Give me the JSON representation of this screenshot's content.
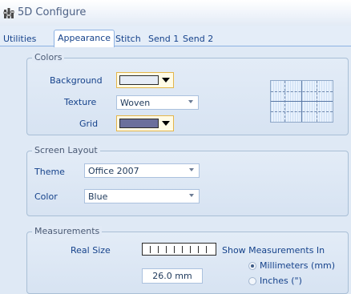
{
  "window": {
    "title": "5D Configure",
    "icon": "configure-app-icon"
  },
  "tabs": [
    {
      "label": "Utilities",
      "active": false
    },
    {
      "label": "Appearance",
      "active": true
    },
    {
      "label": "Stitch",
      "active": false
    },
    {
      "label": "Send 1",
      "active": false
    },
    {
      "label": "Send 2",
      "active": false
    }
  ],
  "colors_group": {
    "title": "Colors",
    "background": {
      "label": "Background",
      "color": "#e6ecf6"
    },
    "texture": {
      "label": "Texture",
      "value": "Woven"
    },
    "grid": {
      "label": "Grid",
      "color": "#6b6f9c"
    }
  },
  "screen_layout_group": {
    "title": "Screen Layout",
    "theme": {
      "label": "Theme",
      "value": "Office 2007"
    },
    "color": {
      "label": "Color",
      "value": "Blue"
    }
  },
  "measurements_group": {
    "title": "Measurements",
    "real_size_label": "Real Size",
    "real_size_value": "26.0 mm",
    "show_in_label": "Show Measurements In",
    "units": [
      {
        "label": "Millimeters (mm)",
        "selected": true
      },
      {
        "label": "Inches (\")",
        "selected": false
      }
    ]
  },
  "accent_colors": {
    "tab_border": "#8db2e3",
    "group_border": "#a9bfd6",
    "text": "#15428b"
  }
}
